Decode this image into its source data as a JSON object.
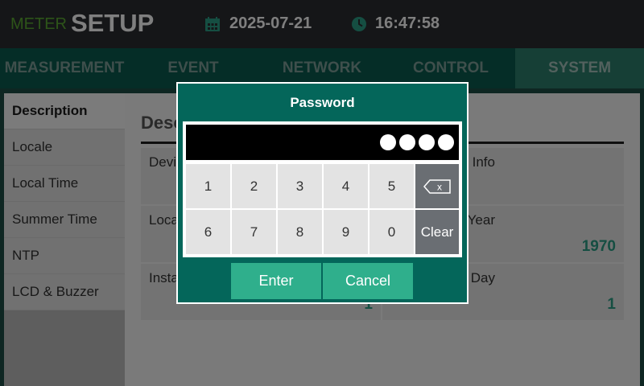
{
  "header": {
    "brand_small": "METER",
    "brand_big": "SETUP",
    "date": "2025-07-21",
    "time": "16:47:58",
    "date_icon": "calendar-icon",
    "time_icon": "clock-icon",
    "brand_color": "#5aa832"
  },
  "tabs": [
    {
      "label": "MEASUREMENT",
      "active": false
    },
    {
      "label": "EVENT",
      "active": false
    },
    {
      "label": "NETWORK",
      "active": false
    },
    {
      "label": "CONTROL",
      "active": false
    },
    {
      "label": "SYSTEM",
      "active": true
    }
  ],
  "sidebar": {
    "items": [
      {
        "label": "Description",
        "active": true
      },
      {
        "label": "Locale",
        "active": false
      },
      {
        "label": "Local Time",
        "active": false
      },
      {
        "label": "Summer Time",
        "active": false
      },
      {
        "label": "NTP",
        "active": false
      },
      {
        "label": "LCD & Buzzer",
        "active": false
      }
    ]
  },
  "content": {
    "title": "Desc",
    "cells": [
      {
        "label": "Devi",
        "value": ""
      },
      {
        "label": "d Info",
        "value": ""
      },
      {
        "label": "Loca",
        "value": ""
      },
      {
        "label": "Year",
        "value": "1970"
      },
      {
        "label": "Insta",
        "value": "1"
      },
      {
        "label": "Day",
        "value": "1"
      }
    ]
  },
  "modal": {
    "title": "Password",
    "masked_length": 4,
    "keys_row1": [
      "1",
      "2",
      "3",
      "4",
      "5"
    ],
    "keys_row2": [
      "6",
      "7",
      "8",
      "9",
      "0"
    ],
    "backspace_icon": "backspace-icon",
    "backspace_glyph": "x",
    "clear_label": "Clear",
    "enter_label": "Enter",
    "cancel_label": "Cancel",
    "accent": "#2faf8c",
    "panel_color": "#04665a"
  }
}
